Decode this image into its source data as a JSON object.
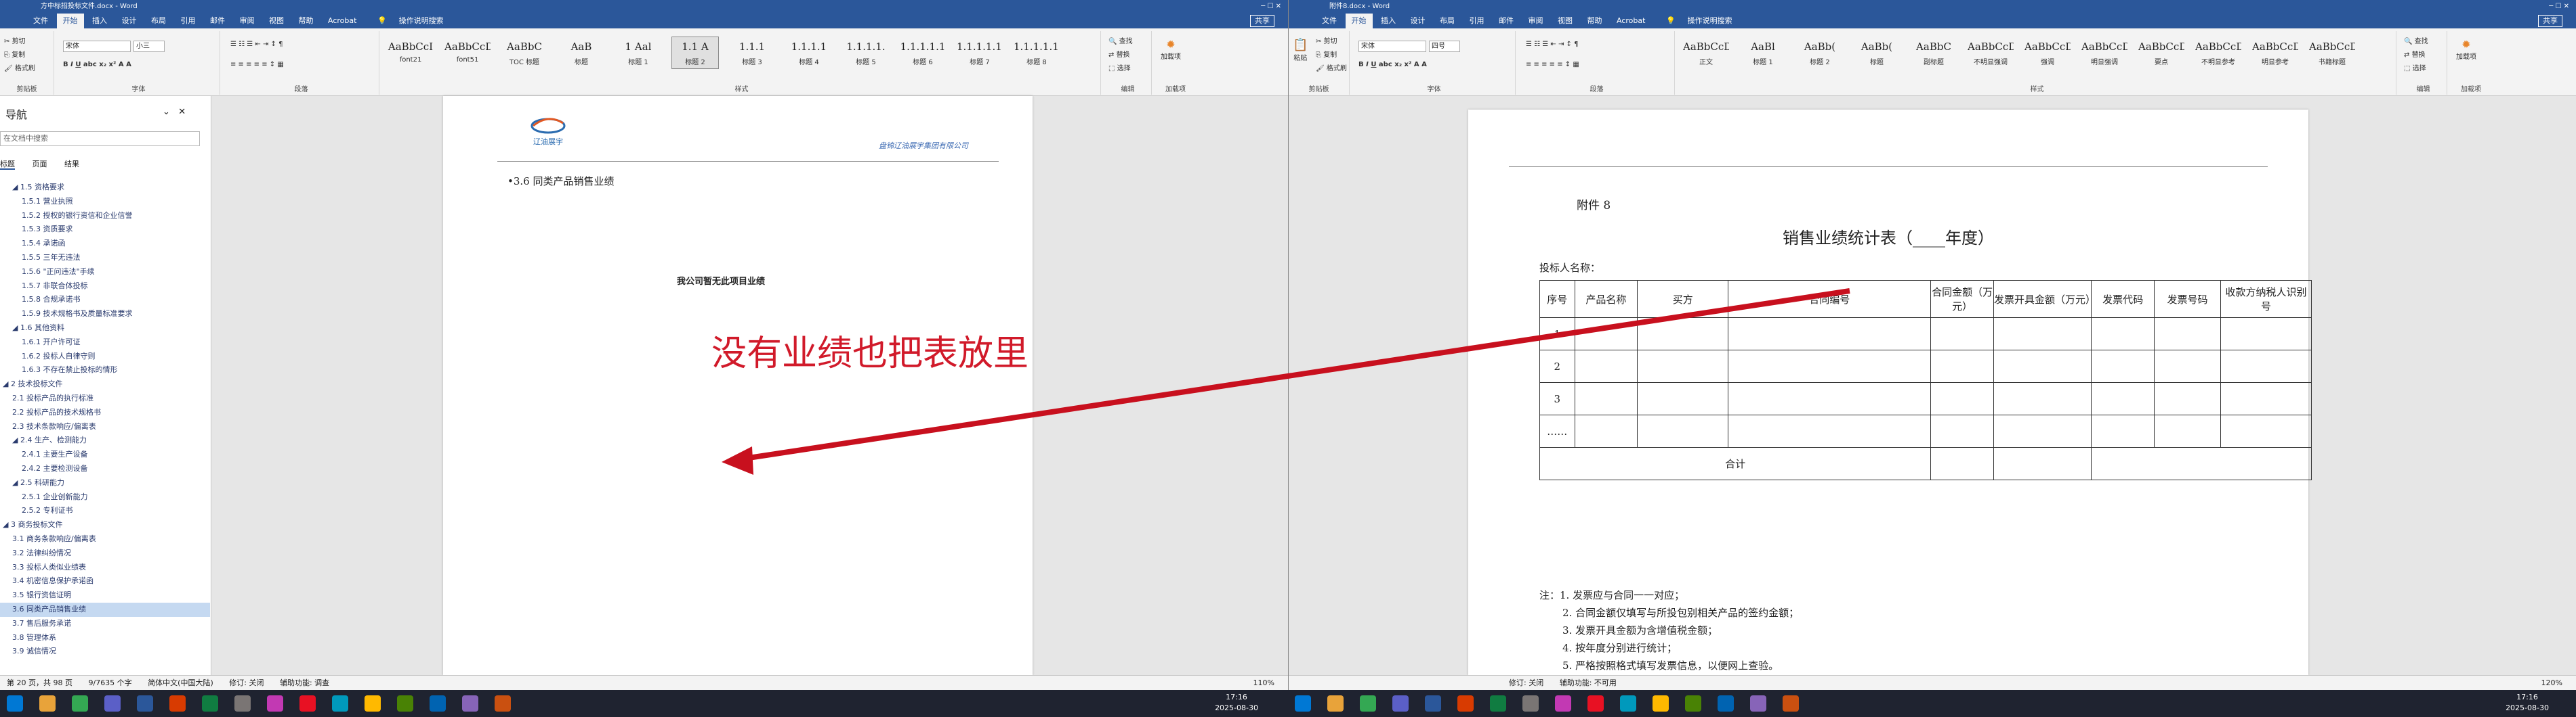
{
  "left": {
    "titlebar": "方中标招投标文件.docx - Word",
    "tabs": [
      "文件",
      "开始",
      "插入",
      "设计",
      "布局",
      "引用",
      "邮件",
      "审阅",
      "视图",
      "帮助",
      "Acrobat",
      "操作说明搜索"
    ],
    "active_tab": "开始",
    "share": "共享",
    "clipboard": {
      "cut": "剪切",
      "copy": "复制",
      "format_painter": "格式刷",
      "label": "剪贴板"
    },
    "font": {
      "name": "宋体",
      "size": "小三",
      "label": "字体"
    },
    "paragraph_label": "段落",
    "styles": [
      {
        "preview": "AaBbCcI",
        "name": "font21"
      },
      {
        "preview": "AaBbCcDd",
        "name": "font51"
      },
      {
        "preview": "AaBbC",
        "name": "TOC 标题"
      },
      {
        "preview": "AaB",
        "name": "标题"
      },
      {
        "preview": "1 Aal",
        "name": "标题 1"
      },
      {
        "preview": "1.1 A",
        "name": "标题 2"
      },
      {
        "preview": "1.1.1",
        "name": "标题 3"
      },
      {
        "preview": "1.1.1.1",
        "name": "标题 4"
      },
      {
        "preview": "1.1.1.1.",
        "name": "标题 5"
      },
      {
        "preview": "1.1.1.1.1",
        "name": "标题 6"
      },
      {
        "preview": "1.1.1.1.1.1",
        "name": "标题 7"
      },
      {
        "preview": "1.1.1.1.1.1.",
        "name": "标题 8"
      }
    ],
    "styles_label": "样式",
    "editing": {
      "find": "查找",
      "replace": "替换",
      "select": "选择",
      "label": "编辑"
    },
    "addin": {
      "name": "加载项",
      "label": "加载项"
    },
    "nav": {
      "title": "导航",
      "search_placeholder": "在文档中搜索",
      "tabs": [
        "标题",
        "页面",
        "结果"
      ],
      "items": [
        {
          "text": "◢ 1.5 资格要求",
          "indent": 1
        },
        {
          "text": "1.5.1 营业执照",
          "indent": 2
        },
        {
          "text": "1.5.2 授权的银行资信和企业信誉",
          "indent": 2
        },
        {
          "text": "1.5.3 资质要求",
          "indent": 2
        },
        {
          "text": "1.5.4 承诺函",
          "indent": 2
        },
        {
          "text": "1.5.5 三年无违法",
          "indent": 2
        },
        {
          "text": "1.5.6 \"正问违法\"手续",
          "indent": 2
        },
        {
          "text": "1.5.7 非联合体投标",
          "indent": 2
        },
        {
          "text": "1.5.8 合规承诺书",
          "indent": 2
        },
        {
          "text": "1.5.9 技术规格书及质量标准要求",
          "indent": 2
        },
        {
          "text": "◢ 1.6 其他资料",
          "indent": 1
        },
        {
          "text": "1.6.1 开户许可证",
          "indent": 2
        },
        {
          "text": "1.6.2 投标人自律守则",
          "indent": 2
        },
        {
          "text": "1.6.3 不存在禁止投标的情形",
          "indent": 2
        },
        {
          "text": "◢ 2 技术投标文件",
          "indent": 0
        },
        {
          "text": "2.1 投标产品的执行标准",
          "indent": 1
        },
        {
          "text": "2.2 投标产品的技术规格书",
          "indent": 1
        },
        {
          "text": "2.3 技术条款响应/偏离表",
          "indent": 1
        },
        {
          "text": "◢ 2.4 生产、检测能力",
          "indent": 1
        },
        {
          "text": "2.4.1 主要生产设备",
          "indent": 2
        },
        {
          "text": "2.4.2 主要检测设备",
          "indent": 2
        },
        {
          "text": "◢ 2.5 科研能力",
          "indent": 1
        },
        {
          "text": "2.5.1 企业创新能力",
          "indent": 2
        },
        {
          "text": "2.5.2 专利证书",
          "indent": 2
        },
        {
          "text": "◢ 3 商务投标文件",
          "indent": 0
        },
        {
          "text": "3.1 商务条款响应/偏离表",
          "indent": 1
        },
        {
          "text": "3.2 法律纠纷情况",
          "indent": 1
        },
        {
          "text": "3.3 投标人类似业绩表",
          "indent": 1
        },
        {
          "text": "3.4 机密信息保护承诺函",
          "indent": 1
        },
        {
          "text": "3.5 银行资信证明",
          "indent": 1
        },
        {
          "text": "3.6 同类产品销售业绩",
          "indent": 1,
          "selected": true
        },
        {
          "text": "3.7 售后服务承诺",
          "indent": 1
        },
        {
          "text": "3.8 管理体系",
          "indent": 1
        },
        {
          "text": "3.9 诚信情况",
          "indent": 1
        }
      ]
    },
    "page": {
      "logo_text": "辽油展宇",
      "header_right": "盘锦辽油展宇集团有限公司",
      "heading": "•3.6    同类产品销售业绩",
      "no_record": "我公司暂无此项目业绩",
      "annotation": "没有业绩也把表放里"
    },
    "status": {
      "page": "第 20 页，共 98 页",
      "words": "9/7635 个字",
      "lang": "简体中文(中国大陆)",
      "track": "修订: 关闭",
      "access": "辅助功能: 调查",
      "zoom": "110%"
    }
  },
  "right": {
    "titlebar": "附件8.docx - Word",
    "tabs": [
      "文件",
      "开始",
      "插入",
      "设计",
      "布局",
      "引用",
      "邮件",
      "审阅",
      "视图",
      "帮助",
      "Acrobat",
      "操作说明搜索"
    ],
    "active_tab": "开始",
    "share": "共享",
    "clipboard": {
      "paste": "粘贴",
      "cut": "剪切",
      "copy": "复制",
      "format_painter": "格式刷",
      "label": "剪贴板"
    },
    "font": {
      "name": "宋体",
      "size": "四号",
      "label": "字体"
    },
    "paragraph_label": "段落",
    "styles": [
      {
        "preview": "AaBbCcDc",
        "name": "正文"
      },
      {
        "preview": "AaBl",
        "name": "标题 1"
      },
      {
        "preview": "AaBb(",
        "name": "标题 2"
      },
      {
        "preview": "AaBb(",
        "name": "标题"
      },
      {
        "preview": "AaBbC",
        "name": "副标题"
      },
      {
        "preview": "AaBbCcDd",
        "name": "不明显强调"
      },
      {
        "preview": "AaBbCcDd",
        "name": "强调"
      },
      {
        "preview": "AaBbCcDd",
        "name": "明显强调"
      },
      {
        "preview": "AaBbCcDd",
        "name": "要点"
      },
      {
        "preview": "AaBbCcDd",
        "name": "不明显参考"
      },
      {
        "preview": "AaBbCcDd",
        "name": "明显参考"
      },
      {
        "preview": "AaBbCcDd",
        "name": "书籍标题"
      }
    ],
    "styles_label": "样式",
    "editing": {
      "find": "查找",
      "replace": "替换",
      "select": "选择",
      "label": "编辑"
    },
    "addin": {
      "name": "加载项",
      "label": "加载项"
    },
    "page": {
      "attachment": "附件 8",
      "title": "销售业绩统计表（____年度）",
      "bidder": "投标人名称：",
      "table_headers": [
        "序号",
        "产品名称",
        "买方",
        "合同编号",
        "合同金额（万元）",
        "发票开具金额（万元）",
        "发票代码",
        "发票号码",
        "收款方纳税人识别号"
      ],
      "rows": [
        "1",
        "2",
        "3",
        "……"
      ],
      "total_label": "合计",
      "notes": [
        "注：1. 发票应与合同一一对应；",
        "2. 合同金额仅填写与所投包别相关产品的签约金额；",
        "3. 发票开具金额为含增值税金额；",
        "4. 按年度分别进行统计；",
        "5. 严格按照格式填写发票信息，以便网上查验。"
      ]
    },
    "status": {
      "track": "修订: 关闭",
      "access": "辅助功能: 不可用",
      "zoom": "120%"
    }
  },
  "taskbar": {
    "left_clock": {
      "time": "17:16",
      "date": "2025-08-30"
    },
    "right_clock": {
      "time": "17:16",
      "date": "2025-08-30"
    }
  },
  "colors": {
    "word_blue": "#2b579a",
    "arrow_red": "#c8101e",
    "annotation_red": "#d11a2a"
  }
}
